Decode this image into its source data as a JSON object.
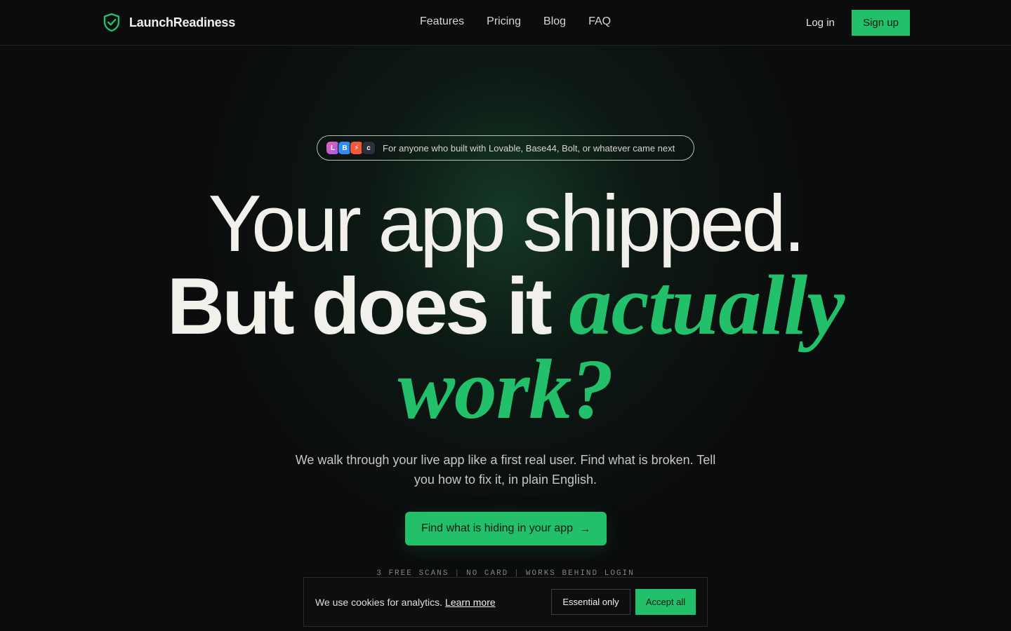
{
  "nav": {
    "brand": "LaunchReadiness",
    "links": [
      "Features",
      "Pricing",
      "Blog",
      "FAQ"
    ],
    "login": "Log in",
    "signup": "Sign up"
  },
  "badge": {
    "logos": [
      "L",
      "B",
      "⚡",
      "c"
    ],
    "text": "For anyone who built with Lovable, Base44, Bolt, or whatever came next"
  },
  "hero": {
    "line1": "Your app shipped.",
    "line2_plain": "But does it ",
    "line2_accent": "actually",
    "line3_accent": "work?",
    "subtext": "We walk through your live app like a first real user. Find what is broken. Tell you how to fix it, in plain English.",
    "cta": "Find what is hiding in your app",
    "cta_arrow": "→",
    "meta": [
      "3 FREE SCANS",
      "NO CARD",
      "WORKS BEHIND LOGIN"
    ],
    "meta_sep": "|"
  },
  "cookie": {
    "text": "We use cookies for analytics.",
    "link": "Learn more",
    "essential": "Essential only",
    "accept": "Accept all"
  },
  "colors": {
    "background": "#0b0c0d",
    "accent": "#22c06b",
    "text": "#f2f0eb"
  }
}
